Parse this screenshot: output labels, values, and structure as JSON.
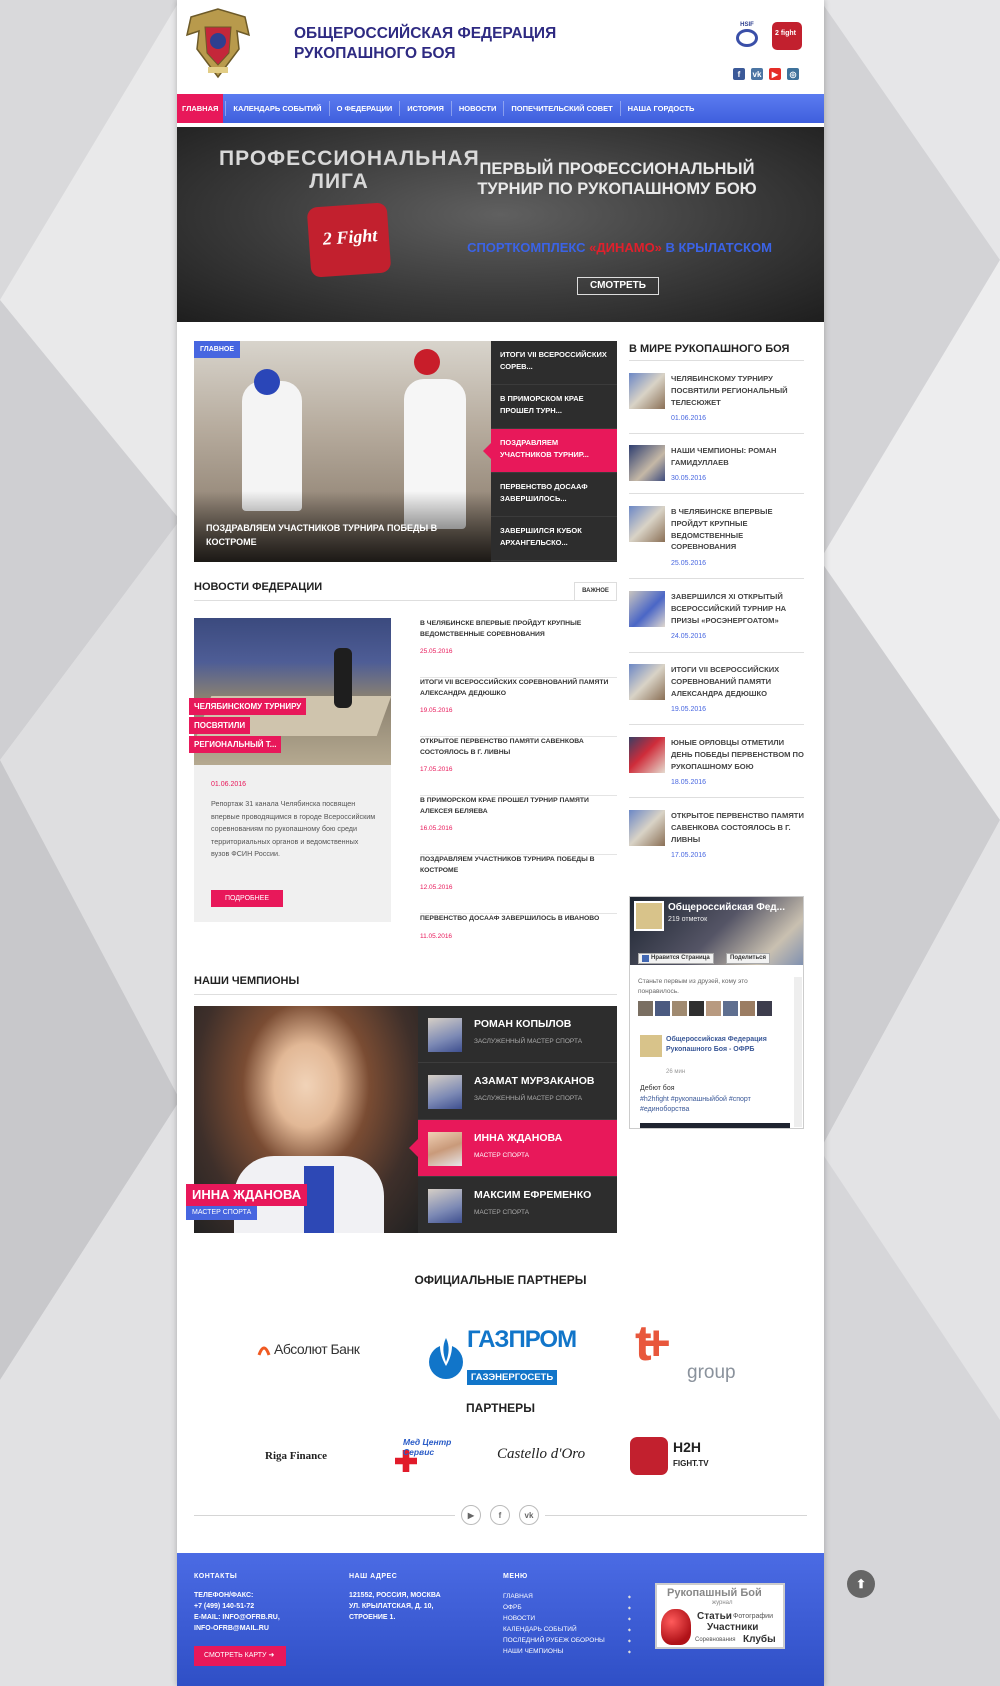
{
  "header": {
    "title": "ОБЩЕРОССИЙСКАЯ ФЕДЕРАЦИЯ РУКОПАШНОГО БОЯ",
    "logo_small_1": "HSIF",
    "logo_small_2": "2 fight",
    "social": [
      "f",
      "vk",
      "▶",
      "◎"
    ]
  },
  "nav": {
    "items": [
      "Главная",
      "Календарь событий",
      "О федерации",
      "История",
      "Новости",
      "Попечительский совет",
      "Наша гордость"
    ]
  },
  "banner": {
    "league": "ПРОФЕССИОНАЛЬНАЯ ЛИГА",
    "logo_text": "2 Fight",
    "title": "ПЕРВЫЙ ПРОФЕССИОНАЛЬНЫЙ ТУРНИР ПО РУКОПАШНОМУ БОЮ",
    "venue_pre": "СПОРТКОМПЛЕКС ",
    "venue_dynamo": "«ДИНАМО»",
    "venue_post": " В КРЫЛАТСКОМ",
    "button": "СМОТРЕТЬ"
  },
  "slider": {
    "badge": "Главное",
    "caption": "ПОЗДРАВЛЯЕМ УЧАСТНИКОВ ТУРНИРА ПОБЕДЫ В КОСТРОМЕ",
    "items": [
      "ИТОГИ VII ВСЕРОССИЙСКИХ СОРЕВ...",
      "В ПРИМОРСКОМ КРАЕ ПРОШЕЛ ТУРН...",
      "ПОЗДРАВЛЯЕМ УЧАСТНИКОВ ТУРНИР...",
      "ПЕРВЕНСТВО ДОСААФ ЗАВЕРШИЛОСЬ...",
      "ЗАВЕРШИЛСЯ КУБОК АРХАНГЕЛЬСКО..."
    ]
  },
  "world": {
    "title": "В МИРЕ РУКОПАШНОГО БОЯ",
    "items": [
      {
        "title": "ЧЕЛЯБИНСКОМУ ТУРНИРУ ПОСВЯТИЛИ РЕГИОНАЛЬНЫЙ ТЕЛЕСЮЖЕТ",
        "date": "01.06.2016"
      },
      {
        "title": "НАШИ ЧЕМПИОНЫ: РОМАН ГАМИДУЛЛАЕВ",
        "date": "30.05.2016"
      },
      {
        "title": "В ЧЕЛЯБИНСКЕ ВПЕРВЫЕ ПРОЙДУТ КРУПНЫЕ ВЕДОМСТВЕННЫЕ СОРЕВНОВАНИЯ",
        "date": "25.05.2016"
      },
      {
        "title": "ЗАВЕРШИЛСЯ XI ОТКРЫТЫЙ ВСЕРОССИЙСКИЙ ТУРНИР НА ПРИЗЫ «РОСЭНЕРГОАТОМ»",
        "date": "24.05.2016"
      },
      {
        "title": "ИТОГИ VII ВСЕРОССИЙСКИХ СОРЕВНОВАНИЙ ПАМЯТИ АЛЕКСАНДРА ДЕДЮШКО",
        "date": "19.05.2016"
      },
      {
        "title": "ЮНЫЕ ОРЛОВЦЫ ОТМЕТИЛИ ДЕНЬ ПОБЕДЫ ПЕРВЕНСТВОМ ПО РУКОПАШНОМУ БОЮ",
        "date": "18.05.2016"
      },
      {
        "title": "ОТКРЫТОЕ ПЕРВЕНСТВО ПАМЯТИ САВЕНКОВА СОСТОЯЛОСЬ В Г. ЛИВНЫ",
        "date": "17.05.2016"
      }
    ]
  },
  "federation_news": {
    "title": "НОВОСТИ ФЕДЕРАЦИИ",
    "tab": "ВАЖНОЕ",
    "feature": {
      "tags": [
        "ЧЕЛЯБИНСКОМУ ТУРНИРУ",
        "ПОСВЯТИЛИ",
        "РЕГИОНАЛЬНЫЙ Т..."
      ],
      "date": "01.06.2016",
      "text": "Репортаж 31 канала Челябинска посвящен впервые проводящимся в городе Всероссийским соревнованиям по рукопашному бою среди территориальных органов и ведомственных вузов ФСИН России.",
      "button": "ПОДРОБНЕЕ"
    },
    "items": [
      {
        "title": "В ЧЕЛЯБИНСКЕ ВПЕРВЫЕ ПРОЙДУТ КРУПНЫЕ ВЕДОМСТВЕННЫЕ СОРЕВНОВАНИЯ",
        "date": "25.05.2016"
      },
      {
        "title": "ИТОГИ VII ВСЕРОССИЙСКИХ СОРЕВНОВАНИЙ ПАМЯТИ АЛЕКСАНДРА ДЕДЮШКО",
        "date": "19.05.2016"
      },
      {
        "title": "ОТКРЫТОЕ ПЕРВЕНСТВО ПАМЯТИ САВЕНКОВА СОСТОЯЛОСЬ В Г. ЛИВНЫ",
        "date": "17.05.2016"
      },
      {
        "title": "В ПРИМОРСКОМ КРАЕ ПРОШЕЛ ТУРНИР ПАМЯТИ АЛЕКСЕЯ БЕЛЯЕВА",
        "date": "16.05.2016"
      },
      {
        "title": "ПОЗДРАВЛЯЕМ УЧАСТНИКОВ ТУРНИРА ПОБЕДЫ В КОСТРОМЕ",
        "date": "12.05.2016"
      },
      {
        "title": "ПЕРВЕНСТВО ДОСААФ ЗАВЕРШИЛОСЬ В ИВАНОВО",
        "date": "11.05.2016"
      }
    ]
  },
  "champions": {
    "title": "НАШИ ЧЕМПИОНЫ",
    "featured_name": "ИННА ЖДАНОВА",
    "featured_rank": "МАСТЕР СПОРТА",
    "items": [
      {
        "name": "РОМАН КОПЫЛОВ",
        "rank": "ЗАСЛУЖЕННЫЙ МАСТЕР СПОРТА"
      },
      {
        "name": "АЗАМАТ МУРЗАКАНОВ",
        "rank": "ЗАСЛУЖЕННЫЙ МАСТЕР СПОРТА"
      },
      {
        "name": "ИННА ЖДАНОВА",
        "rank": "МАСТЕР СПОРТА"
      },
      {
        "name": "МАКСИМ ЕФРЕМЕНКО",
        "rank": "МАСТЕР СПОРТА"
      }
    ]
  },
  "fb": {
    "page_name": "Общероссийская Фед...",
    "likes": "219 отметок",
    "like_btn": "Нравится Страница",
    "share_btn": "Поделиться",
    "friends_text": "Станьте первым из друзей, кому это понравилось.",
    "post_author": "Общероссийская Федерация Рукопашного Боя - ОФРБ",
    "post_time": "26 мин",
    "post_text": "Дебют боя",
    "post_tags": "#h2hfight #рукопашныйбой #спорт #единоборства"
  },
  "partners": {
    "official_title": "ОФИЦИАЛЬНЫЕ ПАРТНЕРЫ",
    "official": [
      "Абсолют Банк",
      "ГАЗПРОМ",
      "ГАЗЭНЕРГОСЕТЬ",
      "t+",
      "group"
    ],
    "title": "ПАРТНЕРЫ",
    "list": [
      "Riga Finance",
      "Мед Центр Сервис",
      "Castello d'Oro",
      "H2H",
      "FIGHT.TV"
    ]
  },
  "footer": {
    "contacts_h": "КОНТАКТЫ",
    "phone_label": "ТЕЛЕФОН/ФАКС:",
    "phone": "+7 (499) 140-51-72",
    "email_1": "E-MAIL: INFO@OFRB.RU,",
    "email_2": "INFO-OFRB@MAIL.RU",
    "map_btn": "СМОТРЕТЬ КАРТУ",
    "address_h": "НАШ АДРЕС",
    "address": [
      "121552, РОССИЯ, МОСКВА",
      "УЛ. КРЫЛАТСКАЯ, Д. 10,",
      "СТРОЕНИЕ 1."
    ],
    "menu_h": "МЕНЮ",
    "menu": [
      "ГЛАВНАЯ",
      "ОФРБ",
      "НОВОСТИ",
      "КАЛЕНДАРЬ СОБЫТИЙ",
      "ПОСЛЕДНИЙ РУБЕЖ ОБОРОНЫ",
      "НАШИ ЧЕМПИОНЫ"
    ],
    "magazine": {
      "title": "Рукопашный Бой",
      "sub": "журнал",
      "words": [
        "Статьи",
        "Фотографии",
        "Участники",
        "Соревнования",
        "Клубы"
      ]
    }
  },
  "footer_social": [
    "▶",
    "f",
    "vk"
  ],
  "colors": {
    "accent": "#e8185a",
    "brand_blue": "#4766e0",
    "title_blue": "#2e2a82"
  }
}
